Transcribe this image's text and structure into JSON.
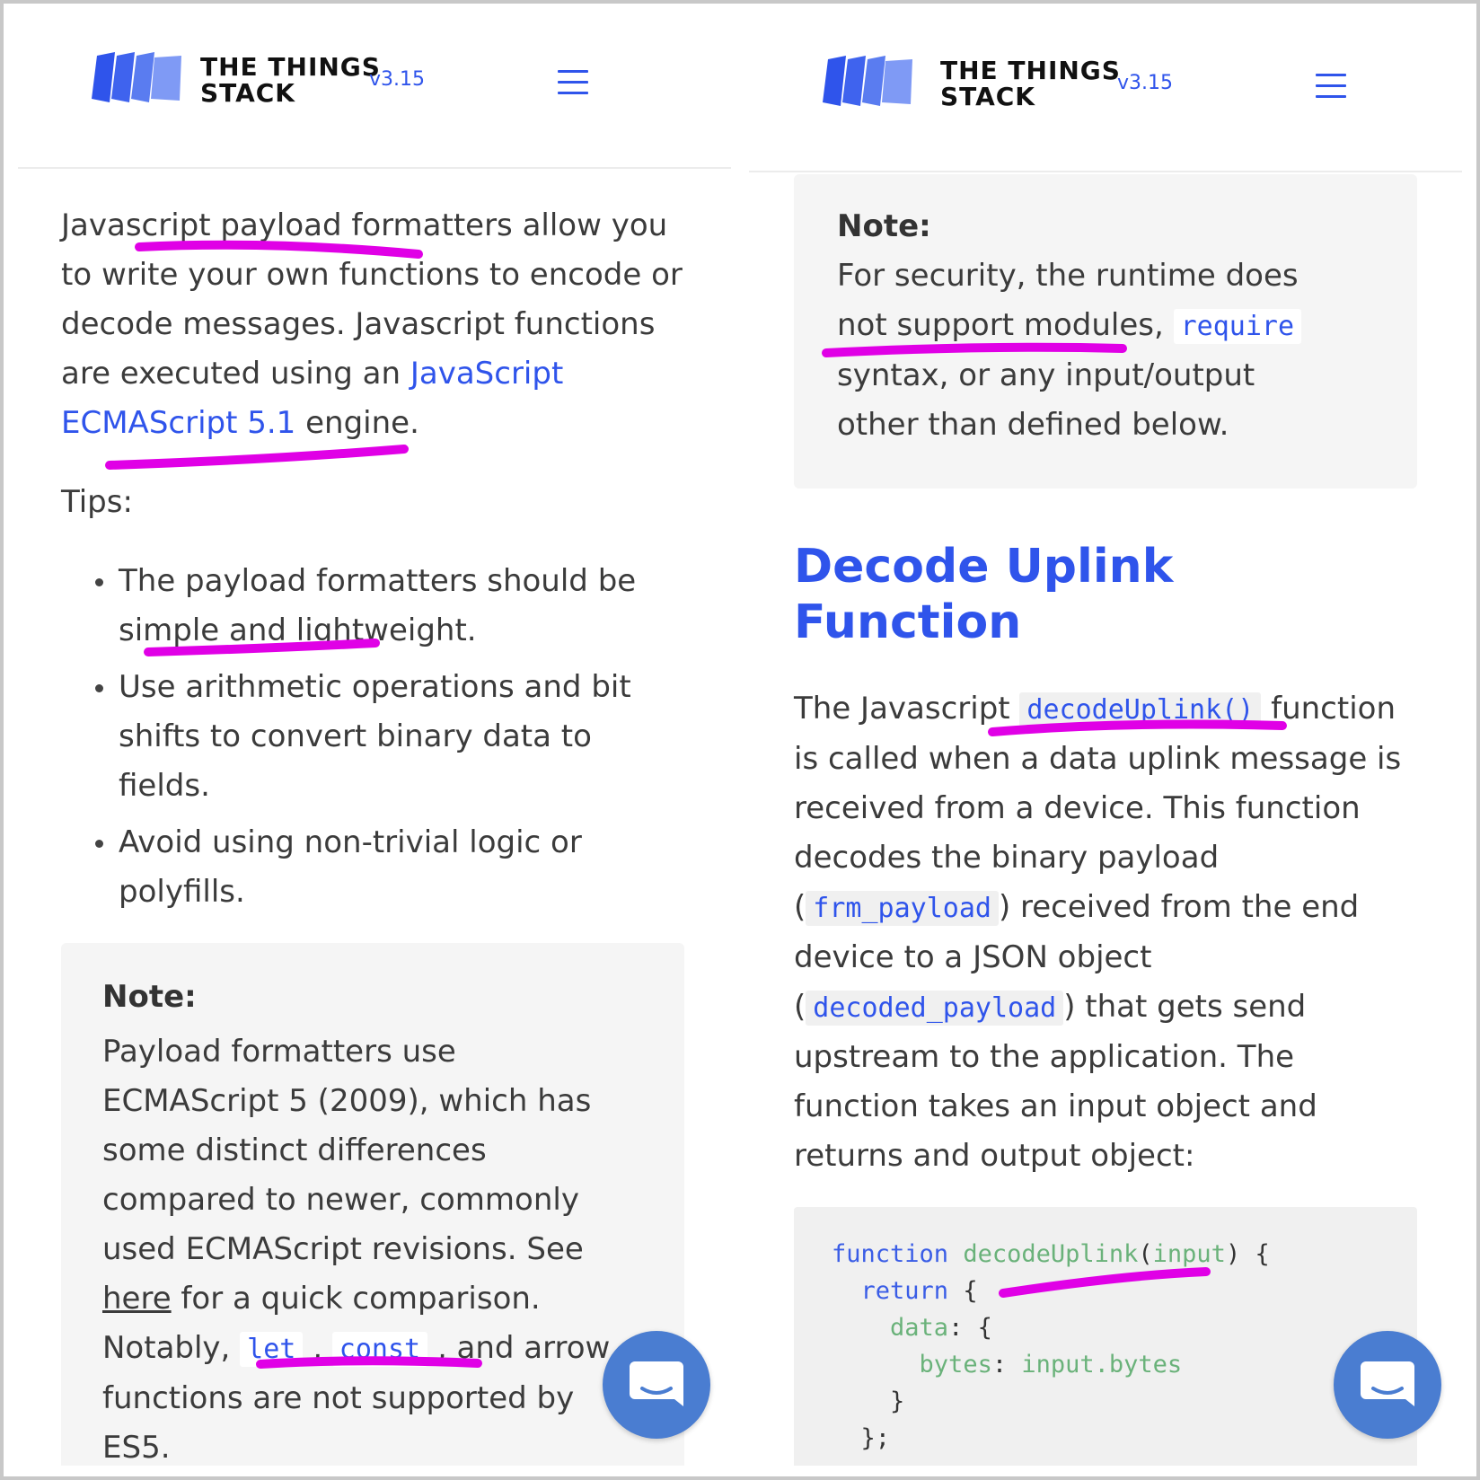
{
  "header": {
    "brand_line1": "THE THINGS",
    "brand_line2": "STACK",
    "version": "v3.15"
  },
  "left": {
    "intro_text": "Javascript payload formatters allow you to write your own functions to encode or decode messages. Javascript functions are executed using an",
    "intro_link": "JavaScript ECMAScript 5.1",
    "intro_suffix": " engine.",
    "tips_label": "Tips:",
    "tips": [
      "The payload formatters should be simple and lightweight.",
      "Use arithmetic operations and bit shifts to convert binary data to fields.",
      "Avoid using non-trivial logic or polyfills."
    ],
    "note": {
      "title": "Note:",
      "text1": "Payload formatters use ECMAScript 5 (2009), which has some distinct differences compared to newer, commonly used ECMAScript revisions. See ",
      "link": "here",
      "text2": " for a quick comparison. Notably, ",
      "code1": "let",
      "sep": " , ",
      "code2": "const",
      "text3": " , and arrow functions are not supported by ES5."
    }
  },
  "right": {
    "note": {
      "title": "Note:",
      "text1": "For security, the runtime does not support modules, ",
      "code": "require",
      "text2": " syntax, or any input/output other than defined below."
    },
    "heading": "Decode Uplink Function",
    "para": {
      "t1": "The Javascript ",
      "c1": "decodeUplink()",
      "t2": " function is called when a data uplink message is received from a device. This function decodes the binary payload (",
      "c2": "frm_payload",
      "t3": ") received from the end device to a JSON object (",
      "c3": "decoded_payload",
      "t4": ") that gets send upstream to the application. The function takes an input object and returns and output object:"
    },
    "code": {
      "l1_kw": "function",
      "l1_fn": "decodeUplink",
      "l1_p1": "(",
      "l1_arg": "input",
      "l1_p2": ") {",
      "l2_kw": "return",
      "l2_p": " {",
      "l3_key": "data",
      "l3_p": ": {",
      "l4_key": "bytes",
      "l4_c": ":",
      "l4_val": "input.bytes",
      "l5": "}",
      "l6": "};"
    }
  },
  "colors": {
    "accent": "#2f54eb",
    "highlight_marker": "#e000e6",
    "chat_button": "#4a7dd1",
    "note_bg": "#f5f5f5"
  }
}
